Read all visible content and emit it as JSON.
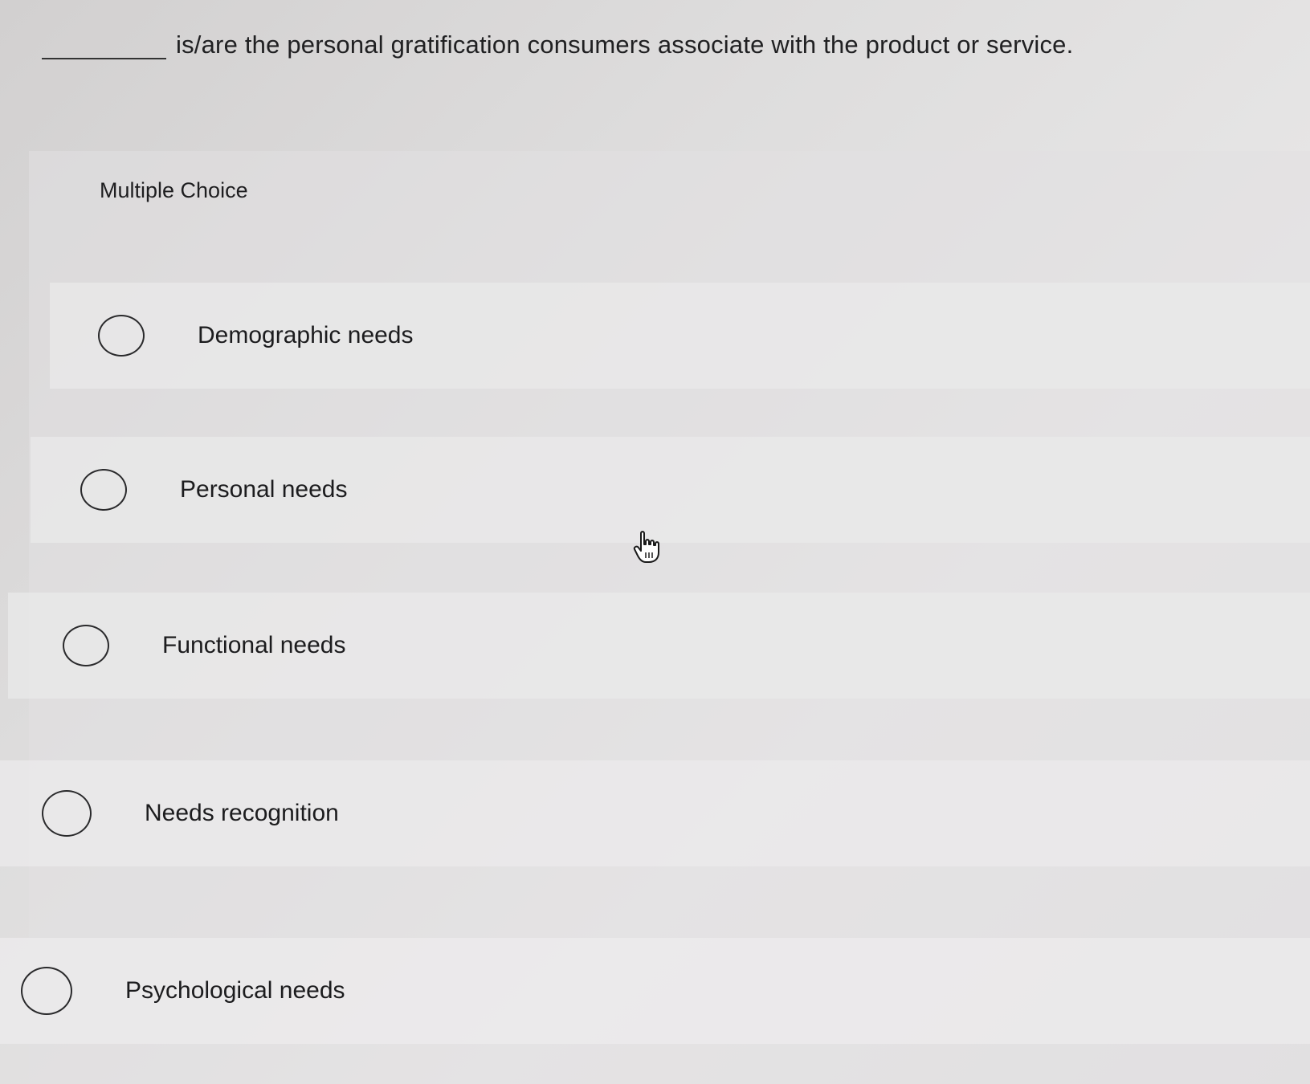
{
  "question": {
    "text": "is/are the personal gratification consumers associate with the product or service."
  },
  "panel": {
    "label": "Multiple Choice"
  },
  "options": [
    {
      "label": "Demographic needs"
    },
    {
      "label": "Personal needs"
    },
    {
      "label": "Functional needs"
    },
    {
      "label": "Needs recognition"
    },
    {
      "label": "Psychological needs"
    }
  ],
  "cursor": {
    "icon": "hand-pointer-icon"
  }
}
